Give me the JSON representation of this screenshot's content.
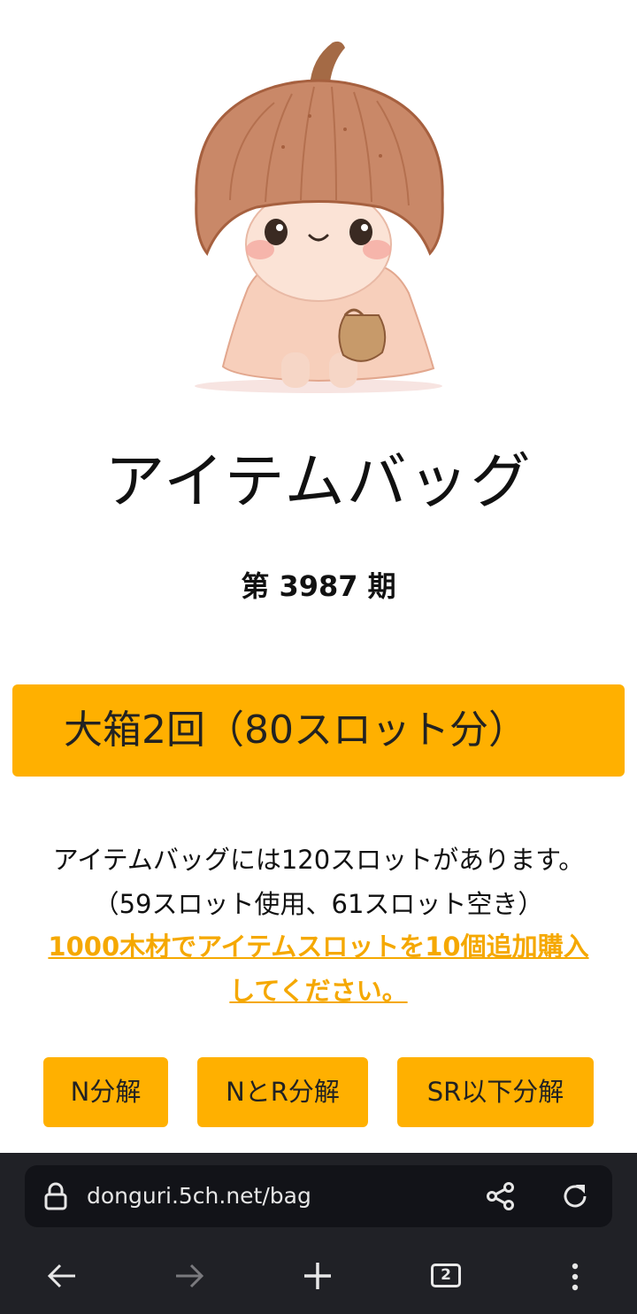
{
  "page": {
    "title": "アイテムバッグ",
    "period_text": "第 3987 期",
    "big_box_button": "大箱2回（80スロット分）",
    "info_line1": "アイテムバッグには120スロットがあります。",
    "info_line2": "（59スロット使用、61スロット空き）",
    "buy_link_line1": "1000木材でアイテムスロットを10個追加購入",
    "buy_link_line2": "してください。",
    "buttons": {
      "n_decompose": "N分解",
      "nr_decompose": "NとR分解",
      "sr_decompose": "SR以下分解"
    }
  },
  "colors": {
    "accent": "#FFB000",
    "link": "#F5A800",
    "browser_bar": "#202126"
  },
  "browser": {
    "url": "donguri.5ch.net/bag",
    "tab_count": "2",
    "icons": [
      "lock-icon",
      "share-icon",
      "reload-icon",
      "back-arrow-icon",
      "forward-arrow-icon",
      "new-tab-plus-icon",
      "tabs-icon",
      "more-menu-icon"
    ]
  }
}
